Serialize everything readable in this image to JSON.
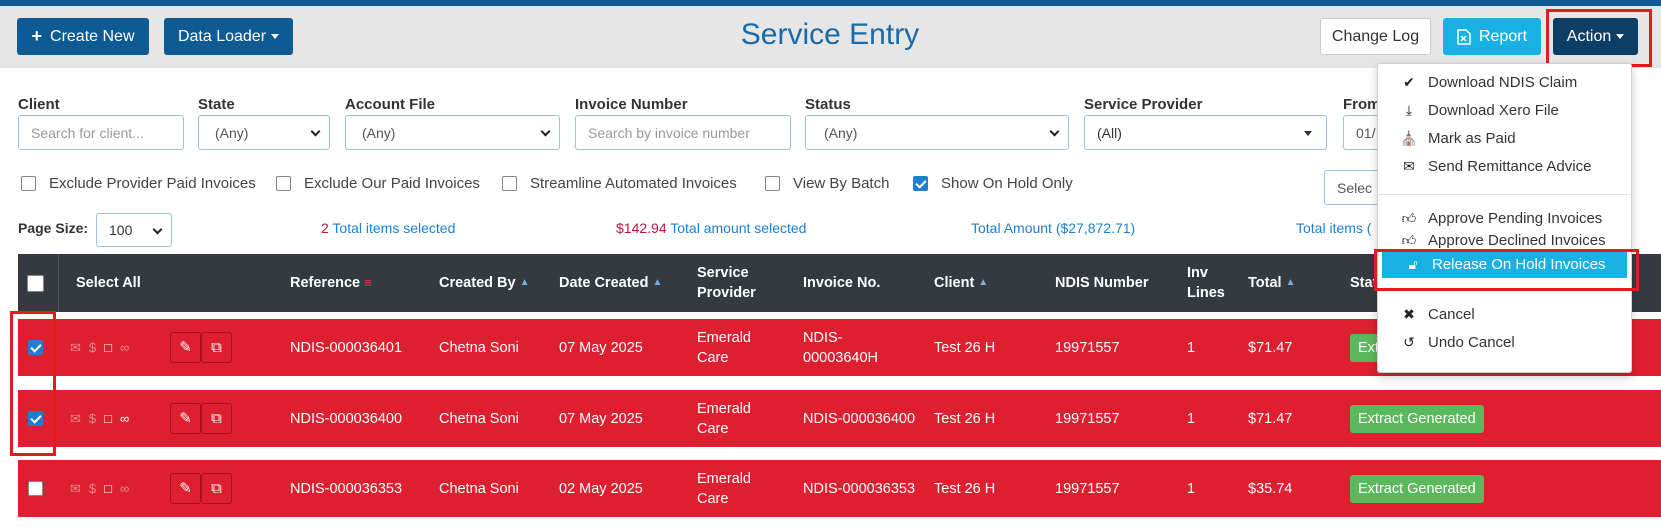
{
  "header": {
    "create_new": "Create New",
    "data_loader": "Data Loader",
    "title": "Service Entry",
    "change_log": "Change Log",
    "report": "Report",
    "action": "Action"
  },
  "filters": {
    "client": {
      "label": "Client",
      "placeholder": "Search for client..."
    },
    "state": {
      "label": "State",
      "value": "(Any)"
    },
    "account_file": {
      "label": "Account File",
      "value": "(Any)"
    },
    "invoice_number": {
      "label": "Invoice Number",
      "placeholder": "Search by invoice number"
    },
    "status": {
      "label": "Status",
      "value": "(Any)"
    },
    "service_provider": {
      "label": "Service Provider",
      "value": "(All)"
    },
    "from": {
      "label": "From",
      "value": "01/"
    }
  },
  "checkboxes": [
    {
      "label": "Exclude Provider Paid Invoices",
      "checked": false
    },
    {
      "label": "Exclude Our Paid Invoices",
      "checked": false
    },
    {
      "label": "Streamline Automated Invoices",
      "checked": false
    },
    {
      "label": "View By Batch",
      "checked": false
    },
    {
      "label": "Show On Hold Only",
      "checked": true
    }
  ],
  "select_partial": "Selec",
  "page_size": {
    "label": "Page Size:",
    "value": "100"
  },
  "stats": {
    "selected_count": "2",
    "selected_label": " Total items selected",
    "amount": "$142.94",
    "amount_label": " Total amount selected",
    "total_amount": "Total Amount ($27,872.71)",
    "total_items": "Total items ("
  },
  "table": {
    "headers": {
      "select_all": "Select All",
      "reference": "Reference",
      "created_by": "Created By",
      "date_created": "Date Created",
      "service_provider": "Service Provider",
      "invoice_no": "Invoice No.",
      "client": "Client",
      "ndis_number": "NDIS Number",
      "inv_lines": "Inv Lines",
      "total": "Total",
      "status": "Stat"
    },
    "rows": [
      {
        "checked": true,
        "reference": "NDIS-000036401",
        "created_by": "Chetna Soni",
        "date_created": "07 May 2025",
        "service_provider": "Emerald Care",
        "invoice_no": "NDIS-00003640H",
        "client": "Test 26 H",
        "ndis_number": "19971557",
        "inv_lines": "1",
        "total": "$71.47",
        "status": "Extr"
      },
      {
        "checked": true,
        "reference": "NDIS-000036400",
        "created_by": "Chetna Soni",
        "date_created": "07 May 2025",
        "service_provider": "Emerald Care",
        "invoice_no": "NDIS-000036400",
        "client": "Test 26 H",
        "ndis_number": "19971557",
        "inv_lines": "1",
        "total": "$71.47",
        "status": "Extract Generated"
      },
      {
        "checked": false,
        "reference": "NDIS-000036353",
        "created_by": "Chetna Soni",
        "date_created": "02 May 2025",
        "service_provider": "Emerald Care",
        "invoice_no": "NDIS-000036353",
        "client": "Test 26 H",
        "ndis_number": "19971557",
        "inv_lines": "1",
        "total": "$35.74",
        "status": "Extract Generated"
      }
    ]
  },
  "action_menu": {
    "download_ndis": "Download NDIS Claim",
    "download_xero": "Download Xero File",
    "mark_paid": "Mark as Paid",
    "send_remittance": "Send Remittance Advice",
    "approve_pending": "Approve Pending Invoices",
    "approve_declined": "Approve Declined Invoices",
    "release_hold": "Release On Hold Invoices",
    "cancel": "Cancel",
    "undo_cancel": "Undo Cancel"
  },
  "colors": {
    "primary": "#0d5a94",
    "accent": "#17b2e3",
    "row_red": "#dd1f2f",
    "badge_green": "#5cb85c"
  }
}
